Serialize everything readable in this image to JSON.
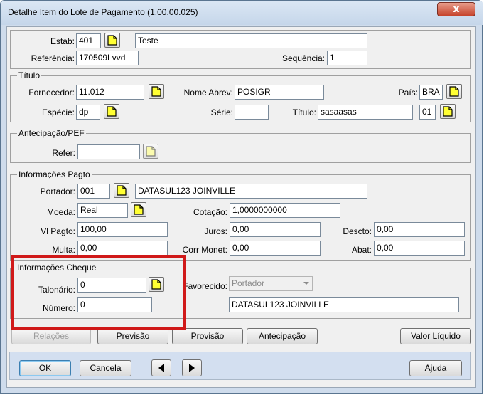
{
  "window": {
    "title": "Detalhe Item do Lote de Pagamento (1.00.00.025)",
    "close_glyph": "x"
  },
  "header": {
    "estab_label": "Estab:",
    "estab_value": "401",
    "estab_name": "Teste",
    "referencia_label": "Referência:",
    "referencia_value": "170509Lvvd",
    "sequencia_label": "Sequência:",
    "sequencia_value": "1"
  },
  "titulo_group": {
    "legend": "Título",
    "fornecedor_label": "Fornecedor:",
    "fornecedor_value": "11.012",
    "nome_abrev_label": "Nome Abrev:",
    "nome_abrev_value": "POSIGR",
    "pais_label": "País:",
    "pais_value": "BRA",
    "especie_label": "Espécie:",
    "especie_value": "dp",
    "serie_label": "Série:",
    "serie_value": "",
    "titulo_label": "Título:",
    "titulo_value": "sasaasas",
    "parcela_value": "01"
  },
  "antecipacao_group": {
    "legend": "Antecipação/PEF",
    "refer_label": "Refer:",
    "refer_value": ""
  },
  "pagto_group": {
    "legend": "Informações Pagto",
    "portador_label": "Portador:",
    "portador_value": "001",
    "portador_name": "DATASUL123 JOINVILLE",
    "moeda_label": "Moeda:",
    "moeda_value": "Real",
    "cotacao_label": "Cotação:",
    "cotacao_value": "1,0000000000",
    "vl_pagto_label": "Vl Pagto:",
    "vl_pagto_value": "100,00",
    "juros_label": "Juros:",
    "juros_value": "0,00",
    "descto_label": "Descto:",
    "descto_value": "0,00",
    "multa_label": "Multa:",
    "multa_value": "0,00",
    "corr_monet_label": "Corr Monet:",
    "corr_monet_value": "0,00",
    "abat_label": "Abat:",
    "abat_value": "0,00"
  },
  "cheque_group": {
    "legend": "Informações Cheque",
    "talonario_label": "Talonário:",
    "talonario_value": "0",
    "numero_label": "Número:",
    "numero_value": "0",
    "favorecido_label": "Favorecido:",
    "favorecido_value": "Portador",
    "favorecido_name": "DATASUL123 JOINVILLE"
  },
  "action_buttons": {
    "relacoes": "Relações",
    "previsao": "Previsão",
    "provisao": "Provisão",
    "antecipacao": "Antecipação",
    "valor_liquido": "Valor Líquido"
  },
  "footer": {
    "ok": "OK",
    "cancela": "Cancela",
    "ajuda": "Ajuda"
  },
  "colors": {
    "highlight": "#d01919",
    "zoom_icon": "#ffff33",
    "titlebar": "#c5d6ea"
  }
}
